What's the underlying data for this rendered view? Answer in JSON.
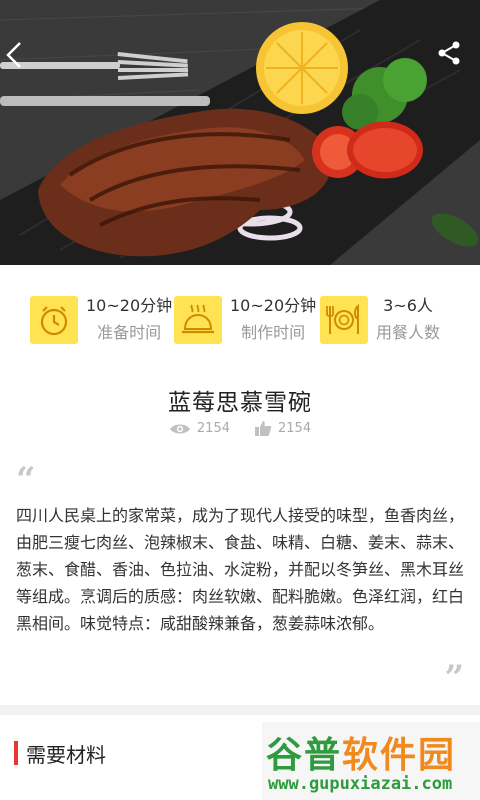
{
  "hero": {
    "image": "steak-with-lemon-broccoli-tomato"
  },
  "nav": {
    "back_icon": "chevron-left-icon",
    "share_icon": "share-icon"
  },
  "stats": [
    {
      "icon": "clock-icon",
      "value": "10~20分钟",
      "label": "准备时间"
    },
    {
      "icon": "cloche-icon",
      "value": "10~20分钟",
      "label": "制作时间"
    },
    {
      "icon": "cutlery-icon",
      "value": "3~6人",
      "label": "用餐人数"
    }
  ],
  "recipe": {
    "title": "蓝莓思慕雪碗",
    "views": "2154",
    "likes": "2154",
    "description": "四川人民桌上的家常菜，成为了现代人接受的味型，鱼香肉丝，由肥三瘦七肉丝、泡辣椒末、食盐、味精、白糖、姜末、蒜末、葱末、食醋、香油、色拉油、水淀粉，并配以冬笋丝、黑木耳丝等组成。烹调后的质感：肉丝软嫩、配料脆嫩。色泽红润，红白黑相间。味觉特点：咸甜酸辣兼备，葱姜蒜味浓郁。"
  },
  "section": {
    "title": "需要材料"
  },
  "watermark": {
    "logo_part1": "谷普",
    "logo_part2": "软件园",
    "url": "www.gupuxiazai.com"
  },
  "colors": {
    "accent_yellow": "#ffe352",
    "section_bar": "#e8382b",
    "muted": "#999999"
  }
}
